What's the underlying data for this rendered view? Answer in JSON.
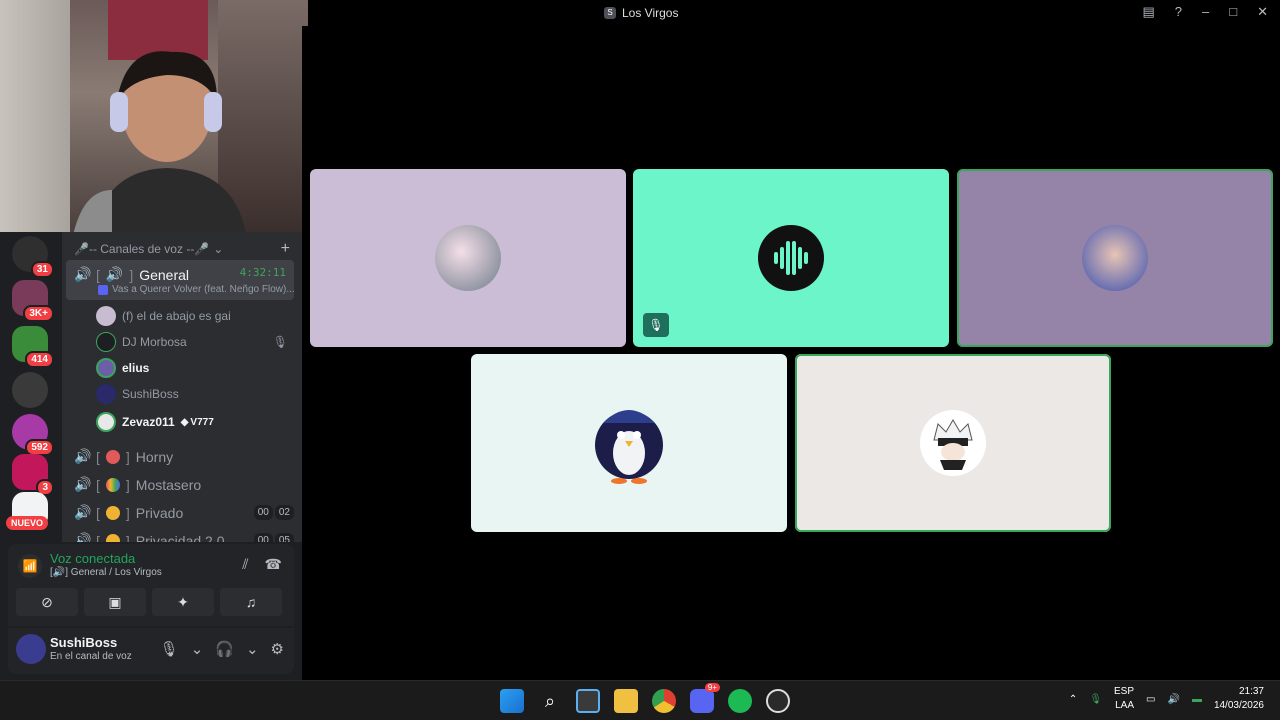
{
  "window": {
    "title": "Los Virgos"
  },
  "titlebar_icons": [
    "inbox-icon",
    "help-icon",
    "minimize-icon",
    "maximize-icon",
    "close-icon"
  ],
  "guild_badges": [
    "31",
    "3K+",
    "414",
    "592",
    "3"
  ],
  "guild_new_label": "NUEVO",
  "category": {
    "label": "🎤-- Canales de voz --🎤"
  },
  "active_channel": {
    "name": "General",
    "brackets_left": "[",
    "brackets_right": "]",
    "timer": "4:32:11",
    "now_playing": "Vas a Querer Volver (feat. Neñgo Flow)..."
  },
  "voice_users": [
    {
      "name": "(f) el de abajo es gai",
      "bold": false
    },
    {
      "name": "DJ Morbosa",
      "bold": false
    },
    {
      "name": "elius",
      "bold": true
    },
    {
      "name": "SushiBoss",
      "bold": false
    },
    {
      "name": "Zevaz011",
      "bold": true,
      "tag": "V777"
    }
  ],
  "other_channels": [
    {
      "name": "Horny",
      "counts": null
    },
    {
      "name": "Mostasero",
      "counts": null
    },
    {
      "name": "Privado",
      "counts": [
        "00",
        "02"
      ]
    },
    {
      "name": "Privacidad 2.0",
      "counts": [
        "00",
        "05"
      ]
    }
  ],
  "voice_panel": {
    "title": "Voz conectada",
    "subtitle": "[🔊] General / Los Virgos"
  },
  "user_panel": {
    "name": "SushiBoss",
    "status": "En el canal de voz"
  },
  "taskbar": {
    "lang": "ESP",
    "layout": "LAA",
    "time": "21:37",
    "date": "14/03/2026",
    "discord_badge": "9+"
  },
  "colors": {
    "tile1": "#cbbdd5",
    "tile2": "#6cf5c8",
    "tile3": "#9584a8",
    "tile4": "#e8f5f2",
    "tile5": "#ece8e6",
    "speaking": "#3ba55c"
  }
}
